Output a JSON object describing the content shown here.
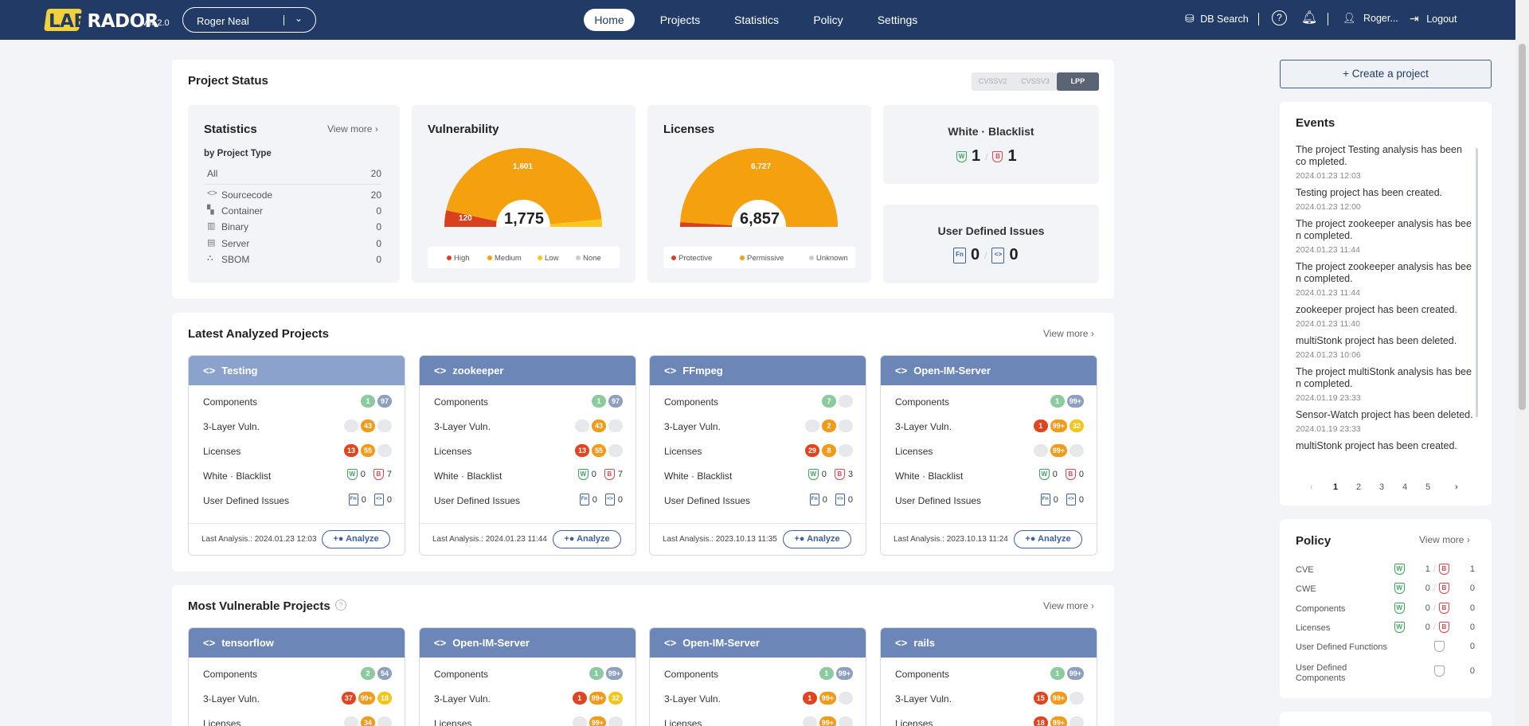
{
  "header": {
    "logo_highlight": "LAB",
    "logo_rest": "RADOR",
    "version": "ver 2.0",
    "user_select": "Roger Neal",
    "nav": [
      "Home",
      "Projects",
      "Statistics",
      "Policy",
      "Settings"
    ],
    "active_nav": "Home",
    "db_search": "DB Search",
    "user_short": "Roger...",
    "logout": "Logout"
  },
  "project_status": {
    "title": "Project Status",
    "toggle": [
      "CVSSV2",
      "CVSSV3",
      "LPP"
    ],
    "toggle_selected": "LPP",
    "statistics": {
      "title": "Statistics",
      "view_more": "View more",
      "subtitle": "by Project Type",
      "rows": [
        {
          "label": "All",
          "value": "20",
          "icon": ""
        },
        {
          "label": "Sourcecode",
          "value": "20",
          "icon": "<>"
        },
        {
          "label": "Container",
          "value": "0",
          "icon": "▚"
        },
        {
          "label": "Binary",
          "value": "0",
          "icon": "▥"
        },
        {
          "label": "Server",
          "value": "0",
          "icon": "▤"
        },
        {
          "label": "SBOM",
          "value": "0",
          "icon": "⛬"
        }
      ]
    },
    "vulnerability": {
      "title": "Vulnerability",
      "total": "1,775",
      "high": 120,
      "medium": 1601,
      "low": 54,
      "none": 0,
      "high_label": "120",
      "medium_label": "1,601",
      "legend": [
        "High",
        "Medium",
        "Low",
        "None"
      ],
      "colors": {
        "high": "#d9411e",
        "medium": "#f5a00f",
        "low": "#f8c91b",
        "none": "#c8ccd4"
      }
    },
    "licenses": {
      "title": "Licenses",
      "total": "6,857",
      "protective": 130,
      "permissive": 6727,
      "unknown": 0,
      "permissive_label": "6,727",
      "legend": [
        "Protective",
        "Permissive",
        "Unknown"
      ]
    },
    "white_blacklist": {
      "title": "White · Blacklist",
      "white": "1",
      "black": "1"
    },
    "user_defined": {
      "title": "User Defined Issues",
      "functions": "0",
      "components": "0"
    }
  },
  "latest": {
    "title": "Latest Analyzed Projects",
    "view_more": "View more",
    "row_labels": [
      "Components",
      "3-Layer Vuln.",
      "Licenses",
      "White · Blacklist",
      "User Defined Issues"
    ],
    "last_label": "Last Analysis.:",
    "analyze": "Analyze",
    "projects": [
      {
        "name": "Testing",
        "comp": [
          "1",
          "97"
        ],
        "vuln": [
          "0",
          "43",
          "0"
        ],
        "lic": [
          "13",
          "55",
          "0"
        ],
        "wb": [
          "0",
          "7"
        ],
        "udi": [
          "0",
          "0"
        ],
        "date": "2024.01.23 12:03"
      },
      {
        "name": "zookeeper",
        "comp": [
          "1",
          "97"
        ],
        "vuln": [
          "0",
          "43",
          "0"
        ],
        "lic": [
          "13",
          "55",
          "0"
        ],
        "wb": [
          "0",
          "7"
        ],
        "udi": [
          "0",
          "0"
        ],
        "date": "2024.01.23 11:44"
      },
      {
        "name": "FFmpeg",
        "comp": [
          "7",
          "0"
        ],
        "vuln": [
          "0",
          "2",
          "0"
        ],
        "lic": [
          "29",
          "8",
          "0"
        ],
        "wb": [
          "0",
          "3"
        ],
        "udi": [
          "0",
          "0"
        ],
        "date": "2023.10.13 11:35"
      },
      {
        "name": "Open-IM-Server",
        "comp": [
          "1",
          "99+"
        ],
        "vuln": [
          "1",
          "99+",
          "32"
        ],
        "lic": [
          "0",
          "99+",
          "0"
        ],
        "wb": [
          "0",
          "0"
        ],
        "udi": [
          "0",
          "0"
        ],
        "date": "2023.10.13 11:24"
      }
    ]
  },
  "most_vuln": {
    "title": "Most Vulnerable Projects",
    "view_more": "View more",
    "projects": [
      {
        "name": "tensorflow",
        "comp": [
          "2",
          "54"
        ],
        "vuln": [
          "37",
          "99+",
          "18"
        ],
        "lic": [
          "0",
          "34",
          "0"
        ]
      },
      {
        "name": "Open-IM-Server",
        "comp": [
          "1",
          "99+"
        ],
        "vuln": [
          "1",
          "99+",
          "32"
        ],
        "lic": [
          "0",
          "99+",
          "0"
        ]
      },
      {
        "name": "Open-IM-Server",
        "comp": [
          "1",
          "99+"
        ],
        "vuln": [
          "1",
          "99+",
          "0"
        ],
        "lic": [
          "0",
          "99+",
          "0"
        ]
      },
      {
        "name": "rails",
        "comp": [
          "1",
          "99+"
        ],
        "vuln": [
          "15",
          "99+",
          "0"
        ],
        "lic": [
          "18",
          "99+",
          "0"
        ]
      }
    ]
  },
  "create_project": "Create a project",
  "events": {
    "title": "Events",
    "items": [
      {
        "text": "The project Testing analysis has been co mpleted.",
        "date": "2024.01.23 12:03"
      },
      {
        "text": "Testing project has been created.",
        "date": "2024.01.23 12:00"
      },
      {
        "text": "The project zookeeper analysis has bee n completed.",
        "date": "2024.01.23 11:44"
      },
      {
        "text": "The project zookeeper analysis has bee n completed.",
        "date": "2024.01.23 11:44"
      },
      {
        "text": "zookeeper project has been created.",
        "date": "2024.01.23 11:40"
      },
      {
        "text": "multiStonk project has been deleted.",
        "date": "2024.01.23 10:06"
      },
      {
        "text": "The project multiStonk analysis has bee n completed.",
        "date": "2024.01.19 23:33"
      },
      {
        "text": "Sensor-Watch project has been deleted.",
        "date": "2024.01.19 23:33"
      },
      {
        "text": "multiStonk project has been created.",
        "date": ""
      }
    ],
    "pages": [
      "1",
      "2",
      "3",
      "4",
      "5"
    ],
    "current_page": "1"
  },
  "policy": {
    "title": "Policy",
    "view_more": "View more",
    "rows": [
      {
        "label": "CVE",
        "white": "1",
        "black": "1"
      },
      {
        "label": "CWE",
        "white": "0",
        "black": "0"
      },
      {
        "label": "Components",
        "white": "0",
        "black": "0"
      },
      {
        "label": "Licenses",
        "white": "0",
        "black": "0"
      },
      {
        "label": "User Defined Functions",
        "count": "0"
      },
      {
        "label": "User Defined Components",
        "count": "0"
      }
    ]
  }
}
